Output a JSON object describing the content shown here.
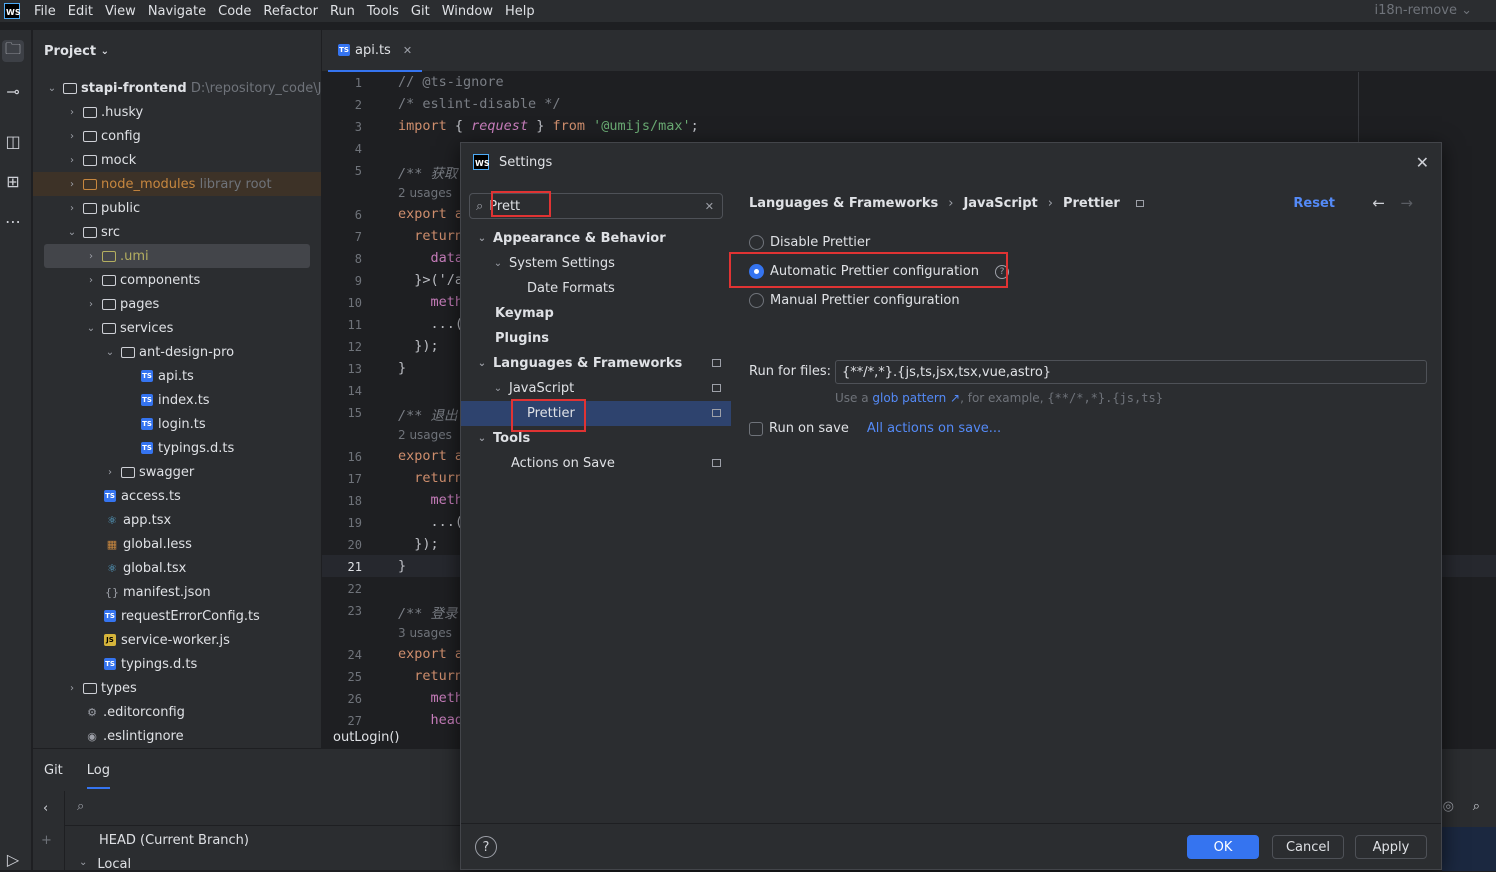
{
  "menubar": {
    "logo": "WS",
    "items": [
      "File",
      "Edit",
      "View",
      "Navigate",
      "Code",
      "Refactor",
      "Run",
      "Tools",
      "Git",
      "Window",
      "Help"
    ],
    "branch": "i18n-remove"
  },
  "project": {
    "title": "Project",
    "root_name": "stapi-frontend",
    "root_path": "D:\\repository_code\\Jiu",
    "items": [
      {
        "label": ".husky"
      },
      {
        "label": "config"
      },
      {
        "label": "mock"
      },
      {
        "label": "node_modules",
        "note": "library root"
      },
      {
        "label": "public"
      },
      {
        "label": "src"
      },
      {
        "label": ".umi"
      },
      {
        "label": "components"
      },
      {
        "label": "pages"
      },
      {
        "label": "services"
      },
      {
        "label": "ant-design-pro"
      },
      {
        "label": "api.ts"
      },
      {
        "label": "index.ts"
      },
      {
        "label": "login.ts"
      },
      {
        "label": "typings.d.ts"
      },
      {
        "label": "swagger"
      },
      {
        "label": "access.ts"
      },
      {
        "label": "app.tsx"
      },
      {
        "label": "global.less"
      },
      {
        "label": "global.tsx"
      },
      {
        "label": "manifest.json"
      },
      {
        "label": "requestErrorConfig.ts"
      },
      {
        "label": "service-worker.js"
      },
      {
        "label": "typings.d.ts"
      },
      {
        "label": "types"
      },
      {
        "label": ".editorconfig"
      },
      {
        "label": ".eslintignore"
      }
    ]
  },
  "editor": {
    "tab": "api.ts",
    "lines": {
      "l1": "// @ts-ignore",
      "l2": "/* eslint-disable */",
      "l3_a": "import",
      "l3_b": " { ",
      "l3_c": "request",
      "l3_d": " } ",
      "l3_e": "from",
      "l3_f": "'@umijs/max'",
      "l3_g": ";",
      "l5": "/** 获取",
      "u1": "2 usages",
      "l6": "export a",
      "l7": "  return",
      "l8": "    data",
      "l9": "  }>('/a",
      "l10": "    meth",
      "l11": "    ...(",
      "l12": "  });",
      "l13": "}",
      "l15": "/** 退出",
      "u2": "2 usages",
      "l16": "export a",
      "l17": "  return",
      "l18": "    meth",
      "l19": "    ...(",
      "l20": "  });",
      "l21": "}",
      "l23": "/** 登录",
      "u3": "3 usages",
      "l24": "export a",
      "l25": "  return",
      "l26": "    meth",
      "l27": "    head"
    },
    "line_numbers": [
      "1",
      "2",
      "3",
      "4",
      "5",
      "6",
      "7",
      "8",
      "9",
      "10",
      "11",
      "12",
      "13",
      "14",
      "15",
      "16",
      "17",
      "18",
      "19",
      "20",
      "21",
      "22",
      "23",
      "24",
      "25",
      "26",
      "27"
    ],
    "breadcrumb": "outLogin()"
  },
  "bottom": {
    "tabs": [
      "Git",
      "Log"
    ],
    "head_label": "HEAD (Current Branch)",
    "local_label": "Local"
  },
  "dialog": {
    "title": "Settings",
    "search_value": "Prett",
    "nav": [
      {
        "label": "Appearance & Behavior"
      },
      {
        "label": "System Settings"
      },
      {
        "label": "Date Formats"
      },
      {
        "label": "Keymap"
      },
      {
        "label": "Plugins"
      },
      {
        "label": "Languages & Frameworks"
      },
      {
        "label": "JavaScript"
      },
      {
        "label": "Prettier"
      },
      {
        "label": "Tools"
      },
      {
        "label": "Actions on Save"
      }
    ],
    "path": [
      "Languages & Frameworks",
      "JavaScript",
      "Prettier"
    ],
    "reset": "Reset",
    "options": {
      "disable": "Disable Prettier",
      "automatic": "Automatic Prettier configuration",
      "manual": "Manual Prettier configuration"
    },
    "selected_option": "automatic",
    "run_for_files_label": "Run for files:",
    "run_for_files_value": "{**/*,*}.{js,ts,jsx,tsx,vue,astro}",
    "hint_a": "Use a ",
    "hint_link": "glob pattern ↗",
    "hint_b": ", for example, ",
    "hint_example": "{**/*,*}.{js,ts}",
    "run_on_save": "Run on save",
    "all_actions_link": "All actions on save...",
    "buttons": {
      "ok": "OK",
      "cancel": "Cancel",
      "apply": "Apply"
    }
  },
  "colors": {
    "accent": "#3574f0",
    "highlight_box": "#e03333",
    "link": "#548af7"
  }
}
